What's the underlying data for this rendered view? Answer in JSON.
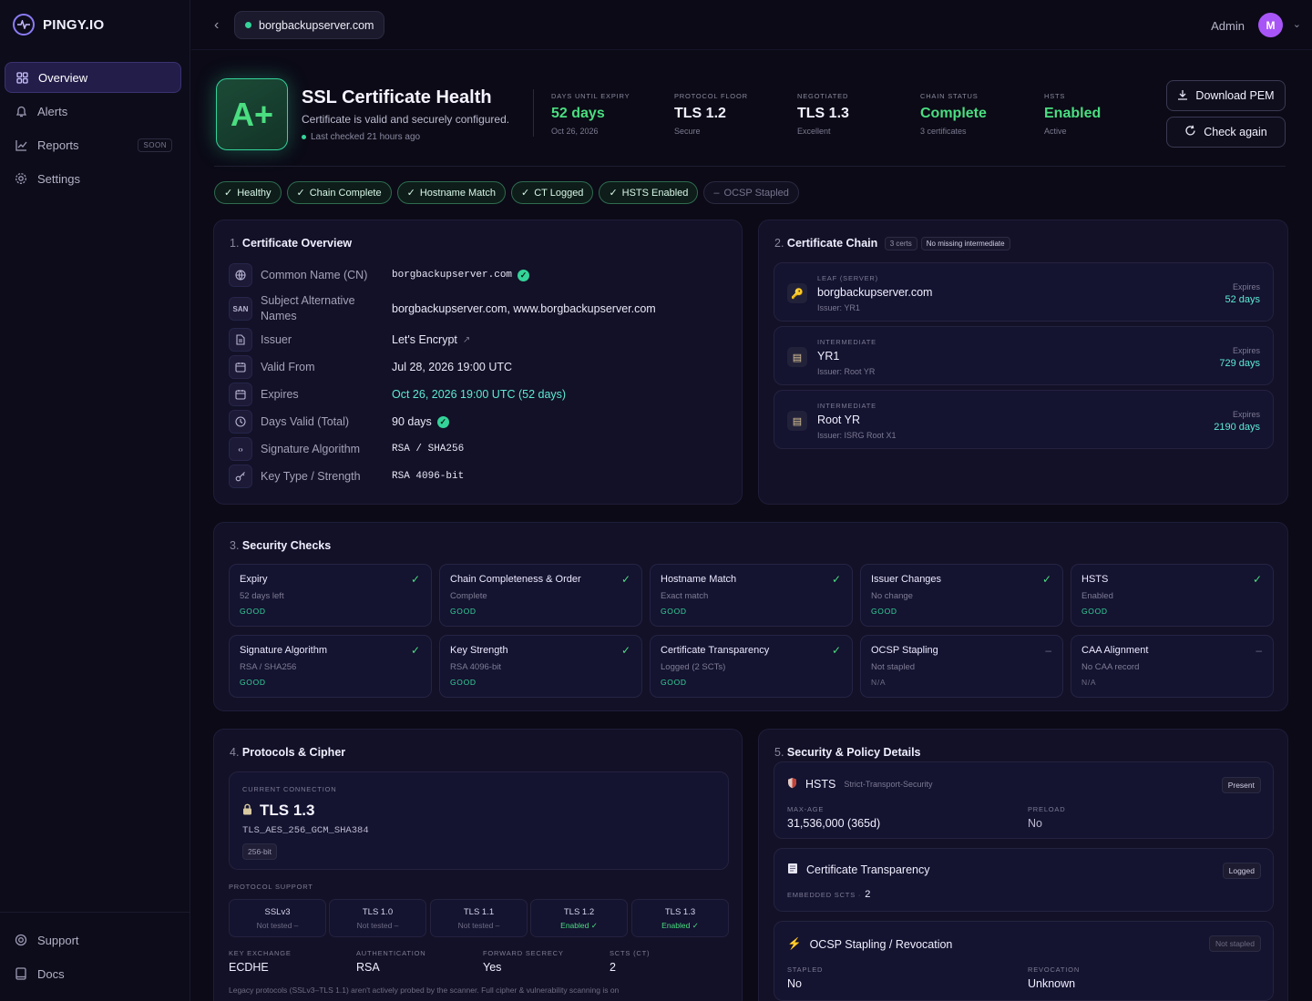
{
  "app": {
    "name": "PINGY.IO"
  },
  "nav": {
    "items": [
      {
        "label": "Overview",
        "icon": "grid-icon"
      },
      {
        "label": "Alerts",
        "icon": "bell-icon"
      },
      {
        "label": "Reports",
        "icon": "chart-icon",
        "badge": "SOON"
      },
      {
        "label": "Settings",
        "icon": "gear-icon"
      }
    ],
    "bottom": [
      {
        "label": "Support",
        "icon": "lifebuoy-icon"
      },
      {
        "label": "Docs",
        "icon": "book-icon"
      }
    ]
  },
  "topbar": {
    "domain": "borgbackupserver.com",
    "user": "Admin",
    "avatar": "M"
  },
  "hero": {
    "grade": "A+",
    "title": "SSL Certificate Health",
    "subtitle": "Certificate is valid and securely configured.",
    "checked": "Last checked 21 hours ago",
    "stats": [
      {
        "label": "DAYS UNTIL EXPIRY",
        "value": "52 days",
        "sub": "Oct 26, 2026"
      },
      {
        "label": "PROTOCOL FLOOR",
        "value": "TLS 1.2",
        "sub": "Secure"
      },
      {
        "label": "NEGOTIATED",
        "value": "TLS 1.3",
        "sub": "Excellent"
      },
      {
        "label": "CHAIN STATUS",
        "value": "Complete",
        "sub": "3 certificates"
      },
      {
        "label": "HSTS",
        "value": "Enabled",
        "sub": "Active"
      }
    ],
    "buttons": {
      "download": "Download PEM",
      "check": "Check again"
    }
  },
  "chips": [
    {
      "label": "Healthy",
      "ok": true
    },
    {
      "label": "Chain Complete",
      "ok": true
    },
    {
      "label": "Hostname Match",
      "ok": true
    },
    {
      "label": "CT Logged",
      "ok": true
    },
    {
      "label": "HSTS Enabled",
      "ok": true
    },
    {
      "label": "OCSP Stapled",
      "ok": false
    }
  ],
  "overview": {
    "num": "1.",
    "title": "Certificate Overview",
    "rows": [
      {
        "label": "Common Name (CN)",
        "value": "borgbackupserver.com"
      },
      {
        "label": "Subject Alternative Names",
        "value": "borgbackupserver.com, www.borgbackupserver.com",
        "icon_text": "SAN"
      },
      {
        "label": "Issuer",
        "value": "Let's Encrypt"
      },
      {
        "label": "Valid From",
        "value": "Jul 28, 2026 19:00 UTC"
      },
      {
        "label": "Expires",
        "value": "Oct 26, 2026 19:00 UTC (52 days)"
      },
      {
        "label": "Days Valid (Total)",
        "value": "90 days"
      },
      {
        "label": "Signature Algorithm",
        "value": "RSA / SHA256"
      },
      {
        "label": "Key Type / Strength",
        "value": "RSA 4096-bit"
      }
    ]
  },
  "chain": {
    "num": "2.",
    "title": "Certificate Chain",
    "count": "3 certs",
    "status": "No missing intermediate",
    "certs": [
      {
        "type": "LEAF (SERVER)",
        "name": "borgbackupserver.com",
        "issuer": "Issuer: YR1",
        "exp_label": "Expires",
        "exp": "52 days"
      },
      {
        "type": "INTERMEDIATE",
        "name": "YR1",
        "issuer": "Issuer: Root YR",
        "exp_label": "Expires",
        "exp": "729 days"
      },
      {
        "type": "INTERMEDIATE",
        "name": "Root YR",
        "issuer": "Issuer: ISRG Root X1",
        "exp_label": "Expires",
        "exp": "2190 days"
      }
    ]
  },
  "checks": {
    "num": "3.",
    "title": "Security Checks",
    "items": [
      {
        "title": "Expiry",
        "sub": "52 days left",
        "status": "GOOD",
        "mark": "✓"
      },
      {
        "title": "Chain Completeness & Order",
        "sub": "Complete",
        "status": "GOOD",
        "mark": "✓"
      },
      {
        "title": "Hostname Match",
        "sub": "Exact match",
        "status": "GOOD",
        "mark": "✓"
      },
      {
        "title": "Issuer Changes",
        "sub": "No change",
        "status": "GOOD",
        "mark": "✓"
      },
      {
        "title": "HSTS",
        "sub": "Enabled",
        "status": "GOOD",
        "mark": "✓"
      },
      {
        "title": "Signature Algorithm",
        "sub": "RSA / SHA256",
        "status": "GOOD",
        "mark": "✓"
      },
      {
        "title": "Key Strength",
        "sub": "RSA 4096-bit",
        "status": "GOOD",
        "mark": "✓"
      },
      {
        "title": "Certificate Transparency",
        "sub": "Logged (2 SCTs)",
        "status": "GOOD",
        "mark": "✓"
      },
      {
        "title": "OCSP Stapling",
        "sub": "Not stapled",
        "status": "N/A",
        "mark": "–"
      },
      {
        "title": "CAA Alignment",
        "sub": "No CAA record",
        "status": "N/A",
        "mark": "–"
      }
    ]
  },
  "protocols": {
    "num": "4.",
    "title": "Protocols & Cipher",
    "current_label": "CURRENT CONNECTION",
    "current": "TLS 1.3",
    "cipher": "TLS_AES_256_GCM_SHA384",
    "bits": "256-bit",
    "support_label": "PROTOCOL SUPPORT",
    "support": [
      {
        "name": "SSLv3",
        "status": "Not tested –"
      },
      {
        "name": "TLS 1.0",
        "status": "Not tested –"
      },
      {
        "name": "TLS 1.1",
        "status": "Not tested –"
      },
      {
        "name": "TLS 1.2",
        "status": "Enabled ✓"
      },
      {
        "name": "TLS 1.3",
        "status": "Enabled ✓"
      }
    ],
    "kv": [
      {
        "label": "KEY EXCHANGE",
        "value": "ECDHE"
      },
      {
        "label": "AUTHENTICATION",
        "value": "RSA"
      },
      {
        "label": "FORWARD SECRECY",
        "value": "Yes"
      },
      {
        "label": "SCTS (CT)",
        "value": "2"
      }
    ],
    "note": "Legacy protocols (SSLv3–TLS 1.1) aren't actively probed by the scanner. Full cipher & vulnerability scanning is on"
  },
  "policy": {
    "num": "5.",
    "title": "Security & Policy Details",
    "hsts": {
      "title": "HSTS",
      "sub": "Strict-Transport-Security",
      "badge": "Present",
      "k1": "MAX-AGE",
      "v1": "31,536,000 (365d)",
      "k2": "PRELOAD",
      "v2": "No"
    },
    "ct": {
      "title": "Certificate Transparency",
      "badge": "Logged",
      "k": "EMBEDDED SCTS ·",
      "v": "2"
    },
    "ocsp": {
      "title": "OCSP Stapling / Revocation",
      "badge": "Not stapled",
      "k1": "STAPLED",
      "v1": "No",
      "k2": "REVOCATION",
      "v2": "Unknown"
    }
  }
}
